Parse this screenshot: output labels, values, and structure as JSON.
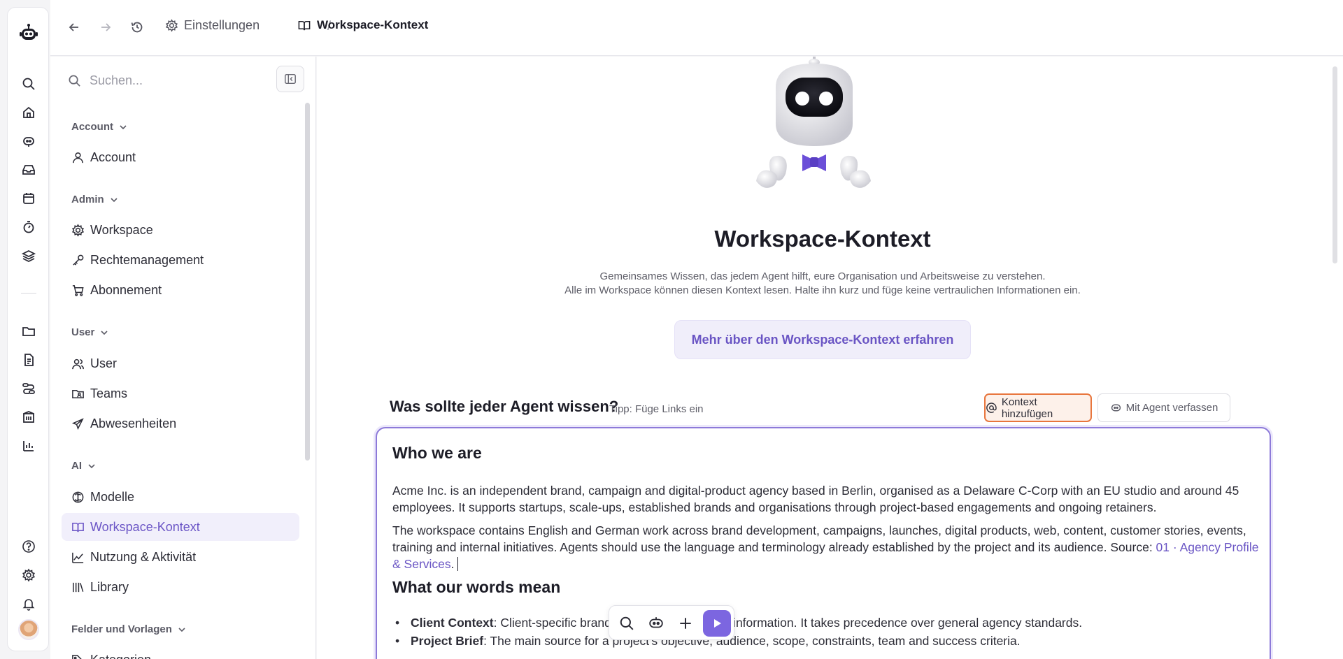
{
  "breadcrumb": {
    "settings_label": "Einstellungen",
    "separator": "/",
    "current_label": "Workspace-Kontext"
  },
  "search": {
    "placeholder": "Suchen..."
  },
  "sidebar": {
    "groups": [
      {
        "label": "Account",
        "items": [
          {
            "label": "Account",
            "icon": "user-icon"
          }
        ]
      },
      {
        "label": "Admin",
        "items": [
          {
            "label": "Workspace",
            "icon": "gear-icon"
          },
          {
            "label": "Rechtemanagement",
            "icon": "key-icon"
          },
          {
            "label": "Abonnement",
            "icon": "cart-icon"
          }
        ]
      },
      {
        "label": "User",
        "items": [
          {
            "label": "User",
            "icon": "users-icon"
          },
          {
            "label": "Teams",
            "icon": "folder-users-icon"
          },
          {
            "label": "Abwesenheiten",
            "icon": "plane-icon"
          }
        ]
      },
      {
        "label": "AI",
        "items": [
          {
            "label": "Modelle",
            "icon": "brain-icon"
          },
          {
            "label": "Workspace-Kontext",
            "icon": "book-icon",
            "active": true
          },
          {
            "label": "Nutzung & Aktivität",
            "icon": "chart-line-icon"
          },
          {
            "label": "Library",
            "icon": "library-icon"
          }
        ]
      },
      {
        "label": "Felder und Vorlagen",
        "items": [
          {
            "label": "Kategorien",
            "icon": "tags-icon"
          }
        ]
      }
    ]
  },
  "main": {
    "title": "Workspace-Kontext",
    "subtitle_line1": "Gemeinsames Wissen, das jedem Agent hilft, eure Organisation und Arbeitsweise zu verstehen.",
    "subtitle_line2": "Alle im Workspace können diesen Kontext lesen. Halte ihn kurz und füge keine vertraulichen Informationen ein.",
    "learn_more_label": "Mehr über den Workspace-Kontext erfahren",
    "question_title": "Was sollte jeder Agent wissen?",
    "tip": "Tipp: Füge Links ein",
    "add_context_label": "Kontext hinzufügen",
    "compose_with_agent_label": "Mit Agent verfassen"
  },
  "editor": {
    "heading1": "Who we are",
    "para1": "Acme Inc. is an independent brand, campaign and digital-product agency based in Berlin, organised as a Delaware C-Corp with an EU studio and around 45 employees. It supports startups, scale-ups, established brands and organisations through project-based engagements and ongoing retainers.",
    "para2_text": "The workspace contains English and German work across brand development, campaigns, launches, digital products, web, content, customer stories, events, training and internal initiatives. Agents should use the language and terminology already established by the project and its audience. Source: ",
    "para2_link": "01 · Agency Profile & Services",
    "para2_end": ".",
    "heading2": "What our words mean",
    "bullets": [
      {
        "term": "Client Context",
        "desc": ": Client-specific brand, tone and operational information. It takes precedence over general agency standards."
      },
      {
        "term": "Project Brief",
        "desc": ": The main source for a project's objective, audience, scope, constraints, team and success criteria."
      }
    ]
  },
  "colors": {
    "accent": "#7c66e0",
    "accent_text": "#6a55c4",
    "highlight": "#e8763d"
  }
}
